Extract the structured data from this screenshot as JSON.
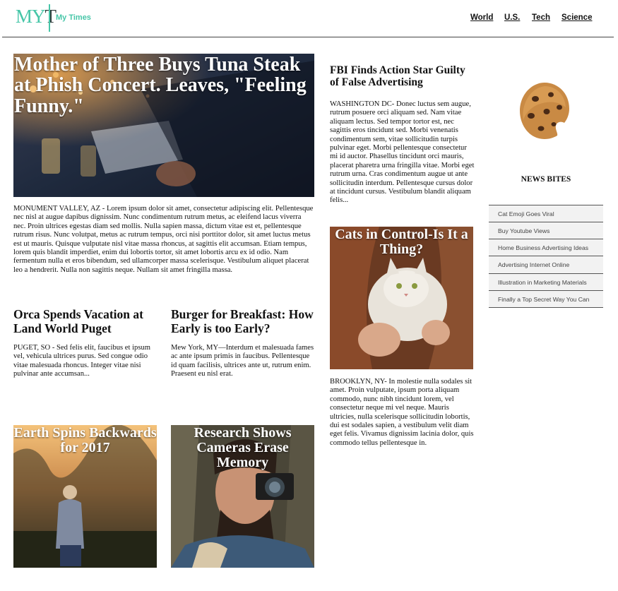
{
  "header": {
    "logo_text_my": "MY",
    "logo_text_t": "T",
    "site_name": "My Times",
    "nav": [
      "World",
      "U.S.",
      "Tech",
      "Science"
    ]
  },
  "main_story": {
    "headline": "Mother of Three Buys Tuna Steak at Phish Concert. Leaves, \"Feeling Funny.\"",
    "body": "MONUMENT VALLEY, AZ - Lorem ipsum dolor sit amet, consectetur adipiscing elit. Pellentesque nec nisl at augue dapibus dignissim. Nunc condimentum rutrum metus, ac eleifend lacus viverra nec. Proin ultrices egestas diam sed mollis. Nulla sapien massa, dictum vitae est et, pellentesque rutrum risus. Nunc volutpat, metus ac rutrum tempus, orci nisi porttitor dolor, sit amet luctus metus est ut mauris. Quisque vulputate nisl vitae massa rhoncus, at sagittis elit accumsan. Etiam tempus, lorem quis blandit imperdiet, enim dui lobortis tortor, sit amet lobortis arcu ex id odio. Nam fermentum nulla et eros bibendum, sed ullamcorper massa scelerisque. Vestibulum aliquet placerat leo a hendrerit. Nulla non sagittis neque. Nullam sit amet fringilla massa."
  },
  "orca_story": {
    "headline": "Orca Spends Vacation at Land World Puget",
    "body": "PUGET, SO - Sed felis elit, faucibus et ipsum vel, vehicula ultrices purus. Sed congue odio vitae malesuada rhoncus. Integer vitae nisi pulvinar ante accumsan..."
  },
  "burger_story": {
    "headline": "Burger for Breakfast: How Early is too Early?",
    "body": "Mew York, MY—Interdum et malesuada fames ac ante ipsum primis in faucibus. Pellentesque id quam facilisis, ultrices ante ut, rutrum enim. Praesent eu nisl erat."
  },
  "earth_story": {
    "headline": "Earth Spins Backwards for 2017"
  },
  "camera_story": {
    "headline": "Research Shows Cameras Erase Memory"
  },
  "fbi_story": {
    "headline": "FBI Finds Action Star Guilty of False Advertising",
    "body": "WASHINGTON DC- Donec luctus sem augue, rutrum posuere orci aliquam sed. Nam vitae aliquam lectus. Sed tempor tortor est, nec sagittis eros tincidunt sed. Morbi venenatis condimentum sem, vitae sollicitudin turpis pulvinar eget. Morbi pellentesque consectetur mi id auctor. Phasellus tincidunt orci mauris, placerat pharetra urna fringilla vitae. Morbi eget rutrum urna. Cras condimentum augue ut ante sollicitudin interdum. Pellentesque cursus dolor at tincidunt cursus. Vestibulum blandit aliquam felis..."
  },
  "cats_story": {
    "headline": "Cats in Control-Is It a Thing?",
    "body": "BROOKLYN, NY- In molestie nulla sodales sit amet. Proin vulputate, ipsum porta aliquam commodo, nunc nibh tincidunt lorem, vel consectetur neque mi vel neque. Mauris ultricies, nulla scelerisque sollicitudin lobortis, dui est sodales sapien, a vestibulum velit diam eget felis. Vivamus dignissim lacinia dolor, quis commodo tellus pellentesque in."
  },
  "sidebar": {
    "heading": "NEWS BITES",
    "items": [
      "Cat Emoji Goes Viral",
      "Buy Youtube Views",
      "Home Business Advertising Ideas",
      "Advertising Internet Online",
      "Illustration in Marketing Materials",
      "Finally a Top Secret Way You Can"
    ]
  },
  "colors": {
    "accent": "#47c6a8",
    "text": "#111111",
    "sidebar_bg": "#f2f2f2"
  }
}
